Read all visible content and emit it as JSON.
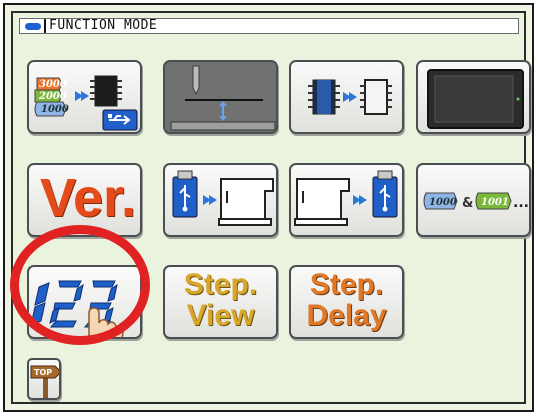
{
  "header": {
    "title": "FUNCTION MODE"
  },
  "buttons": {
    "ver": {
      "label": "Ver."
    },
    "step_view": {
      "line1": "Step.",
      "line2": "View"
    },
    "step_delay": {
      "line1": "Step.",
      "line2": "Delay"
    },
    "top": {
      "label": "TOP"
    },
    "data_select": {
      "values": [
        "3000",
        "2000",
        "1000"
      ]
    },
    "copy_data": {
      "left": "1000",
      "amp": "&",
      "right": "1001",
      "dots": "..."
    }
  },
  "colors": {
    "highlight_circle": "#e02222",
    "background": "#e9f3dd",
    "accent_blue": "#1a63d0",
    "ver_orange": "#e44a1a"
  },
  "icons": [
    "data-to-ic-usb-icon",
    "needle-height-icon",
    "ic-to-ic-icon",
    "screen-icon",
    "usb-to-machine-icon",
    "machine-to-usb-icon",
    "counter-hand-icon",
    "top-signpost-icon"
  ]
}
